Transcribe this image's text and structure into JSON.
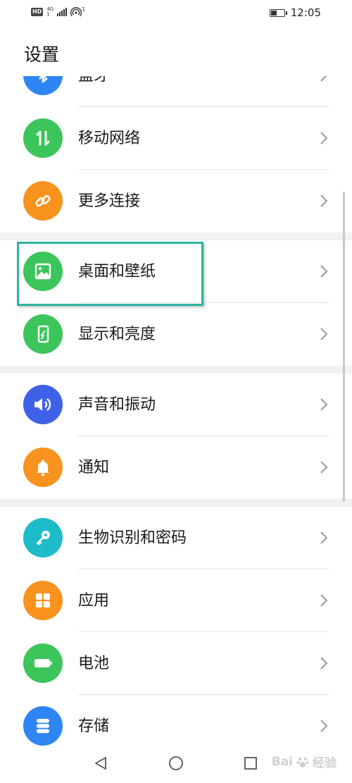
{
  "status_bar": {
    "hd": "HD",
    "network": "4G",
    "network_sub": "1",
    "hotspot_count": "1",
    "battery_level": 0.45,
    "time": "12:05"
  },
  "page_title": "设置",
  "items": [
    {
      "label": "蓝牙",
      "icon": "bluetooth-icon",
      "color": "#2e86f5"
    },
    {
      "label": "移动网络",
      "icon": "mobile-data-icon",
      "color": "#3cc55a"
    },
    {
      "label": "更多连接",
      "icon": "link-icon",
      "color": "#f7931e"
    },
    {
      "label": "桌面和壁纸",
      "icon": "image-icon",
      "color": "#3cc55a"
    },
    {
      "label": "显示和亮度",
      "icon": "phone-brightness-icon",
      "color": "#3cc55a"
    },
    {
      "label": "声音和振动",
      "icon": "speaker-icon",
      "color": "#3f61e8"
    },
    {
      "label": "通知",
      "icon": "bell-icon",
      "color": "#f7931e"
    },
    {
      "label": "生物识别和密码",
      "icon": "key-icon",
      "color": "#1ebcc8"
    },
    {
      "label": "应用",
      "icon": "apps-grid-icon",
      "color": "#f7931e"
    },
    {
      "label": "电池",
      "icon": "battery-icon",
      "color": "#3cc55a"
    },
    {
      "label": "存储",
      "icon": "storage-icon",
      "color": "#2e86f5"
    }
  ],
  "highlight_color": "#2bb5a0",
  "nav": {
    "back": "back-icon",
    "home": "home-icon",
    "recent": "recent-apps-icon"
  },
  "watermark": {
    "text": "Bai",
    "suffix": "经验"
  }
}
